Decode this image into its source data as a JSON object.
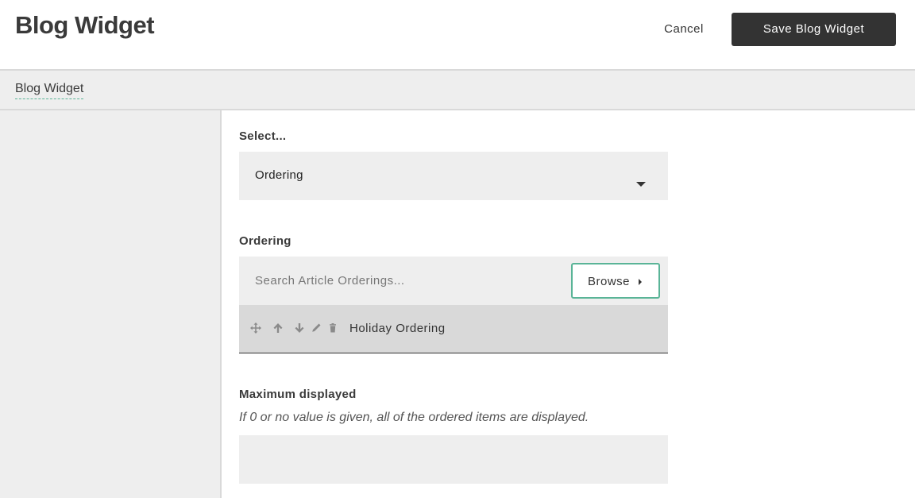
{
  "header": {
    "title": "Blog Widget",
    "cancel_label": "Cancel",
    "save_label": "Save Blog Widget"
  },
  "tabs": [
    {
      "label": "Blog Widget",
      "active": true
    }
  ],
  "form": {
    "select": {
      "label": "Select...",
      "value": "Ordering"
    },
    "ordering": {
      "label": "Ordering",
      "search_placeholder": "Search Article Orderings...",
      "browse_label": "Browse",
      "items": [
        {
          "title": "Holiday Ordering",
          "actions": [
            "move-icon",
            "arrow-up-icon",
            "arrow-down-icon",
            "pencil-icon",
            "trash-icon"
          ]
        }
      ]
    },
    "maximum": {
      "label": "Maximum displayed",
      "help": "If 0 or no value is given, all of the ordered items are displayed.",
      "value": ""
    }
  },
  "colors": {
    "accent": "#5ab497",
    "dark_button": "#333333",
    "panel": "#eeeeee",
    "item_row": "#d9d9d9"
  }
}
